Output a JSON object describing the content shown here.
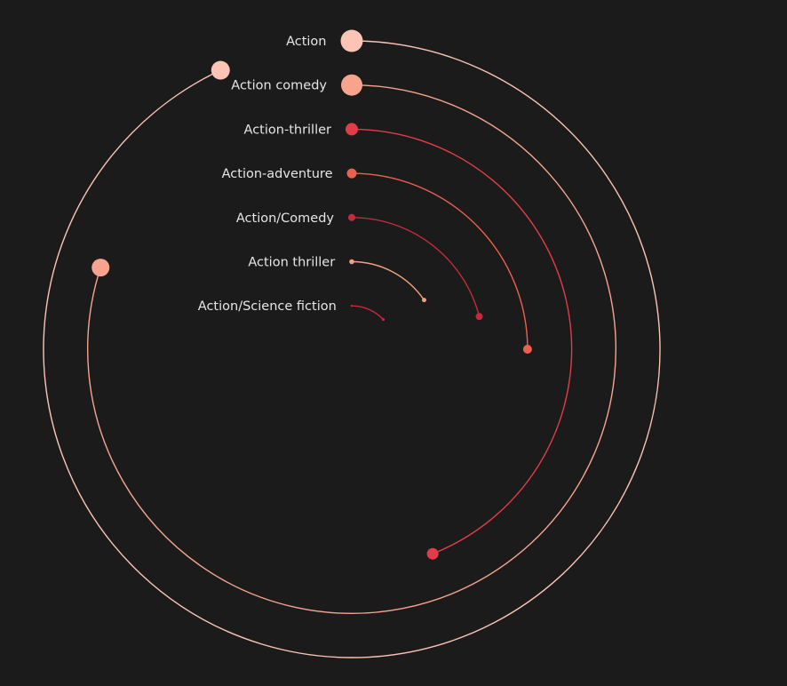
{
  "chart_data": {
    "type": "radial_bar",
    "title": "",
    "series": [
      {
        "category": "Action",
        "value": 0.93,
        "color": "#fcc4b4"
      },
      {
        "category": "Action comedy",
        "value": 0.8,
        "color": "#f7a48f"
      },
      {
        "category": "Action-thriller",
        "value": 0.44,
        "color": "#e23d47"
      },
      {
        "category": "Action-adventure",
        "value": 0.25,
        "color": "#ef5f4e"
      },
      {
        "category": "Action/Comedy",
        "value": 0.21,
        "color": "#c42b3a"
      },
      {
        "category": "Action thriller",
        "value": 0.155,
        "color": "#f4a07f"
      },
      {
        "category": "Action/Science fiction",
        "value": 0.13,
        "color": "#c9283d"
      }
    ]
  }
}
